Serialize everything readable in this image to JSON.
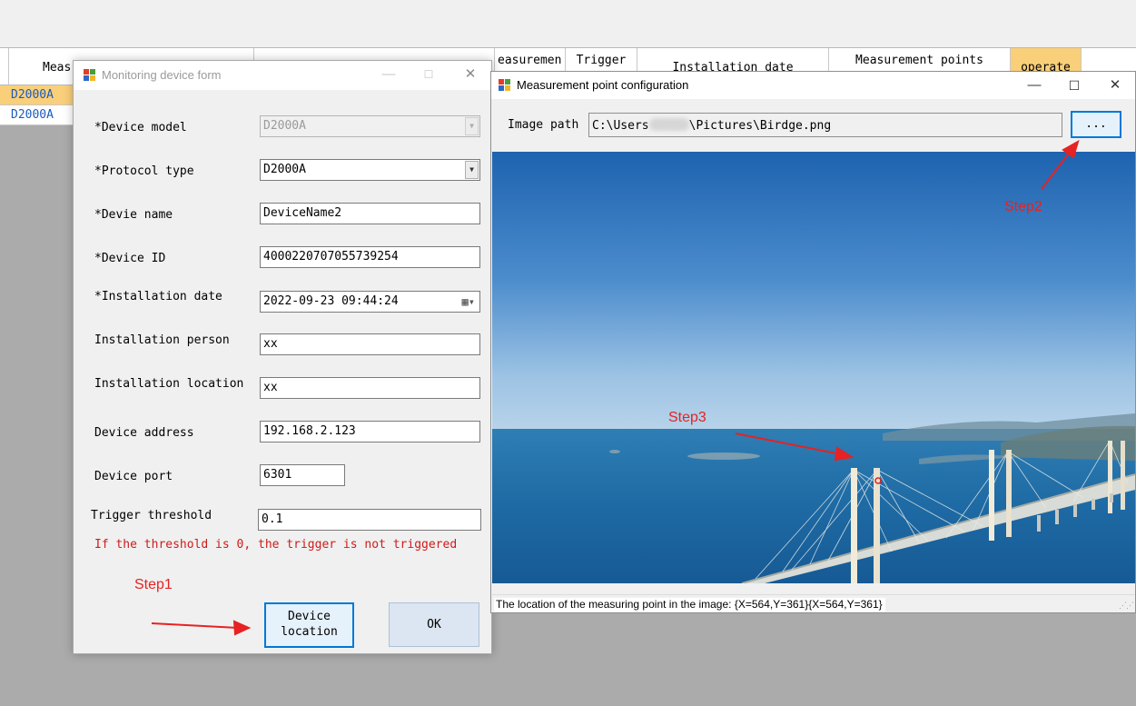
{
  "background_grid": {
    "headers": [
      "Meas",
      "easuremen",
      "Trigger",
      "Installation date",
      "Measurement points",
      "operate"
    ],
    "rows": [
      "D2000A",
      "D2000A"
    ]
  },
  "device_form": {
    "title": "Monitoring device form",
    "fields": {
      "device_model_label": "*Device model",
      "device_model_value": "D2000A",
      "protocol_type_label": "*Protocol type",
      "protocol_type_value": "D2000A",
      "device_name_label": "*Devie name",
      "device_name_value": "DeviceName2",
      "device_id_label": "*Device ID",
      "device_id_value": "4000220707055739254",
      "installation_date_label": "*Installation date",
      "installation_date_value": "2022-09-23 09:44:24",
      "installation_person_label": "Installation person",
      "installation_person_value": "xx",
      "installation_location_label": "Installation location",
      "installation_location_value": "xx",
      "device_address_label": "Device address",
      "device_address_value": "192.168.2.123",
      "device_port_label": "Device port",
      "device_port_value": "6301",
      "trigger_threshold_label": "Trigger threshold",
      "trigger_threshold_value": "0.1"
    },
    "hint": "If the threshold is 0, the trigger is not triggered",
    "device_location_button": [
      "Device",
      "location"
    ],
    "ok_button": "OK"
  },
  "mp_config": {
    "title": "Measurement point configuration",
    "image_path_label": "Image path",
    "image_path_prefix": "C:\\Users",
    "image_path_suffix": "\\Pictures\\Birdge.png",
    "browse_button": "...",
    "status_text": "The location of the measuring point in the image: {X=564,Y=361}{X=564,Y=361}"
  },
  "annotations": {
    "step1": "Step1",
    "step2": "Step2",
    "step3": "Step3"
  },
  "window_icons": {
    "minimize": "minimize-icon",
    "maximize": "maximize-icon",
    "close": "close-icon"
  },
  "colors": {
    "accent": "#0078d7",
    "selection": "#f9cf7a",
    "annotation_red": "#e62222",
    "hint_red": "#d01a1a"
  }
}
